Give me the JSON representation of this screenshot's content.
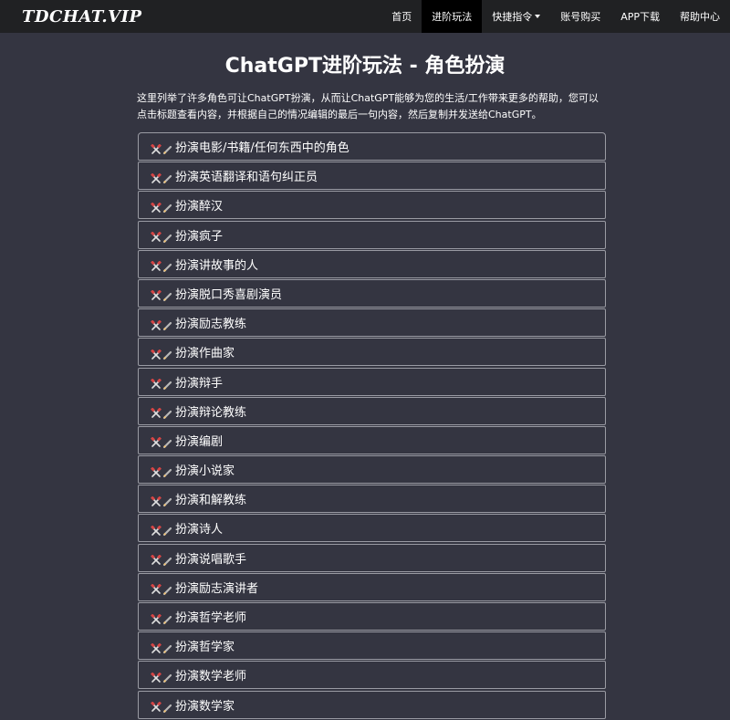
{
  "header": {
    "brand": "TDCHAT.VIP",
    "nav": [
      {
        "label": "首页",
        "active": false,
        "dropdown": false
      },
      {
        "label": "进阶玩法",
        "active": true,
        "dropdown": false
      },
      {
        "label": "快捷指令",
        "active": false,
        "dropdown": true
      },
      {
        "label": "账号购买",
        "active": false,
        "dropdown": false
      },
      {
        "label": "APP下载",
        "active": false,
        "dropdown": false
      },
      {
        "label": "帮助中心",
        "active": false,
        "dropdown": false
      }
    ]
  },
  "main": {
    "title": "ChatGPT进阶玩法 - 角色扮演",
    "intro": "这里列举了许多角色可让ChatGPT扮演，从而让ChatGPT能够为您的生活/工作带来更多的帮助，您可以点击标题查看内容，并根据自己的情况编辑的最后一句内容，然后复制并发送给ChatGPT。",
    "item_icons": [
      "tools-icon",
      "pencil-icon"
    ],
    "roles": [
      "扮演电影/书籍/任何东西中的角色",
      "扮演英语翻译和语句纠正员",
      "扮演醉汉",
      "扮演疯子",
      "扮演讲故事的人",
      "扮演脱口秀喜剧演员",
      "扮演励志教练",
      "扮演作曲家",
      "扮演辩手",
      "扮演辩论教练",
      "扮演编剧",
      "扮演小说家",
      "扮演和解教练",
      "扮演诗人",
      "扮演说唱歌手",
      "扮演励志演讲者",
      "扮演哲学老师",
      "扮演哲学家",
      "扮演数学老师",
      "扮演数学家"
    ]
  },
  "colors": {
    "background": "#343541",
    "navbar": "#202123",
    "nav_active": "#000000",
    "item_border": "#9a9ba3",
    "text": "#ffffff"
  }
}
